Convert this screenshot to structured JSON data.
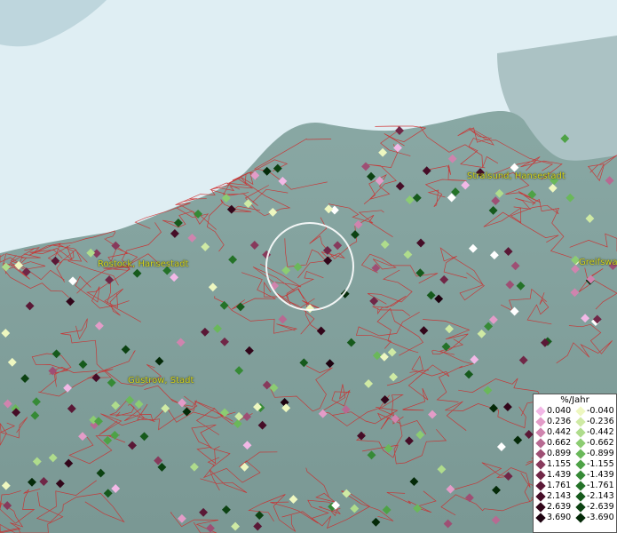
{
  "labels": {
    "rostock": "Rostock, Hansestadt",
    "stralsund": "Stralsund, Hansestadt",
    "greifswald": "Greifswa",
    "guestrow": "Güstrow, Stadt"
  },
  "legend": {
    "title": "%/Jahr",
    "positive": [
      {
        "value": "0.040",
        "color": "#f2b8e6"
      },
      {
        "value": "0.236",
        "color": "#e39cc8"
      },
      {
        "value": "0.442",
        "color": "#cf84ae"
      },
      {
        "value": "0.662",
        "color": "#b76a92"
      },
      {
        "value": "0.899",
        "color": "#9e4f74"
      },
      {
        "value": "1.155",
        "color": "#873a5c"
      },
      {
        "value": "1.439",
        "color": "#702747"
      },
      {
        "value": "1.761",
        "color": "#5a1836"
      },
      {
        "value": "2.143",
        "color": "#460d27"
      },
      {
        "value": "2.639",
        "color": "#32061a"
      },
      {
        "value": "3.690",
        "color": "#1e0210"
      }
    ],
    "negative": [
      {
        "value": "-0.040",
        "color": "#eef7c0"
      },
      {
        "value": "-0.236",
        "color": "#cfeaa4"
      },
      {
        "value": "-0.442",
        "color": "#afdc8c"
      },
      {
        "value": "-0.662",
        "color": "#8ccc72"
      },
      {
        "value": "-0.899",
        "color": "#6ab85a"
      },
      {
        "value": "-1.155",
        "color": "#4ea246"
      },
      {
        "value": "-1.439",
        "color": "#368a36"
      },
      {
        "value": "-1.761",
        "color": "#247228"
      },
      {
        "value": "-2.143",
        "color": "#165a1c"
      },
      {
        "value": "-2.639",
        "color": "#0c4212"
      },
      {
        "value": "-3.690",
        "color": "#042a08"
      }
    ]
  },
  "colors": {
    "water": "#dfeef3",
    "land": "#7f9f9c",
    "borders": "#d02828",
    "label": "#d8d820"
  }
}
